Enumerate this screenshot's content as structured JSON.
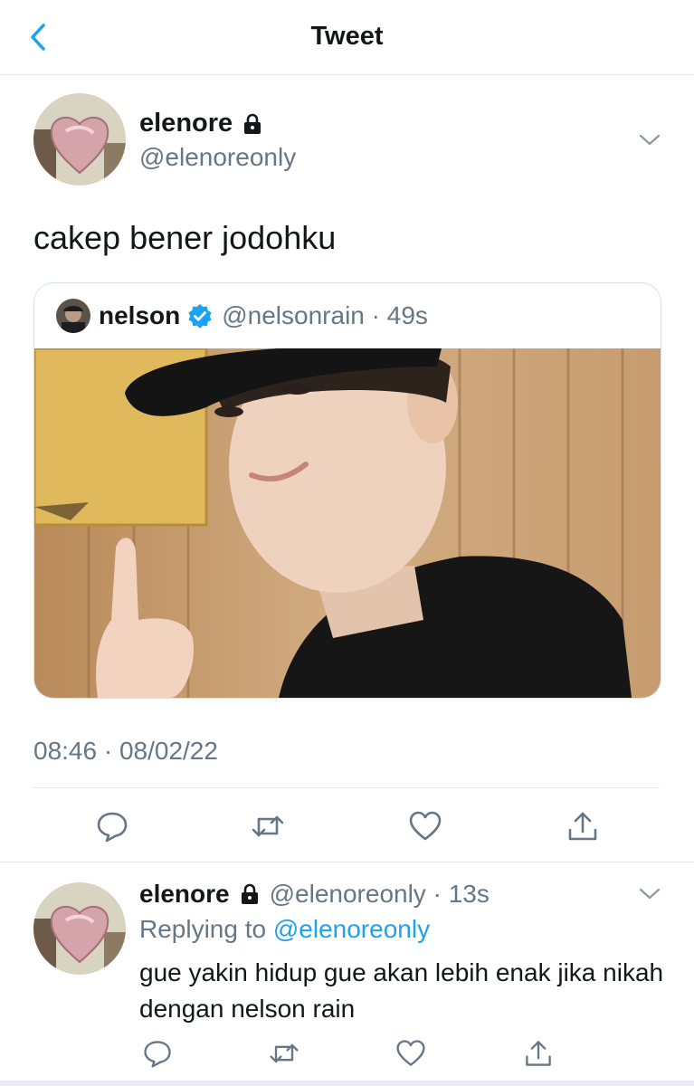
{
  "header": {
    "title": "Tweet"
  },
  "tweet": {
    "name": "elenore",
    "handle": "@elenoreonly",
    "text": "cakep bener jodohku",
    "timestamp": "08:46 · 08/02/22"
  },
  "quote": {
    "name": "nelson",
    "handle": "@nelsonrain",
    "time": "49s"
  },
  "reply": {
    "name": "elenore",
    "handle": "@elenoreonly",
    "time": "13s",
    "replying_prefix": "Replying to",
    "replying_to": "@elenoreonly",
    "text": "gue yakin hidup gue akan lebih enak jika nikah dengan nelson rain"
  },
  "icons": {
    "back": "chevron-left-icon",
    "lock": "lock-icon",
    "verified": "verified-badge-icon",
    "more": "chevron-down-icon",
    "reply": "comment-icon",
    "retweet": "retweet-icon",
    "like": "heart-icon",
    "share": "share-icon"
  },
  "colors": {
    "accent": "#1da1f2",
    "muted": "#657786",
    "text": "#14171a"
  }
}
